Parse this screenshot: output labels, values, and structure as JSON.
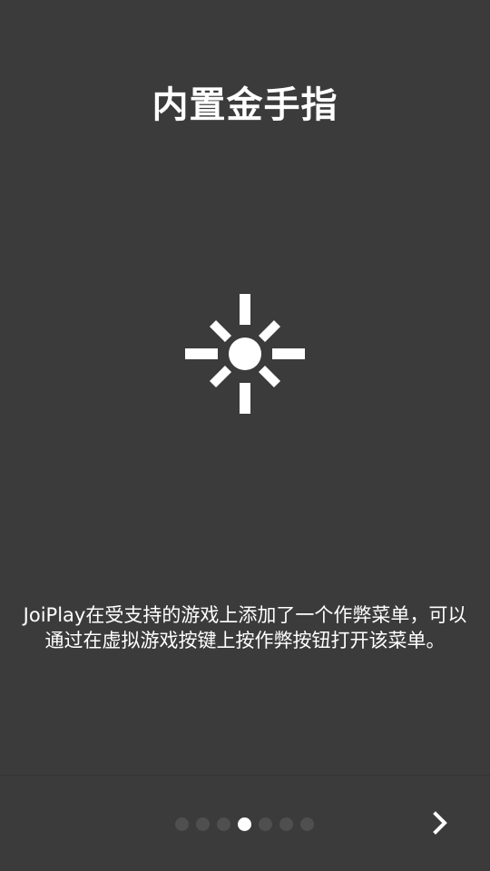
{
  "page": {
    "title": "内置金手指",
    "description": "JoiPlay在受支持的游戏上添加了一个作弊菜单，可以通过在虚拟游戏按键上按作弊按钮打开该菜单。",
    "feature_icon": "brightness-icon"
  },
  "pager": {
    "total": 7,
    "current": 4,
    "next_icon": "chevron-right-icon"
  },
  "colors": {
    "background": "#3b3b3b",
    "text": "#ffffff",
    "dot_inactive": "#4f4f4f",
    "dot_active": "#ffffff"
  }
}
